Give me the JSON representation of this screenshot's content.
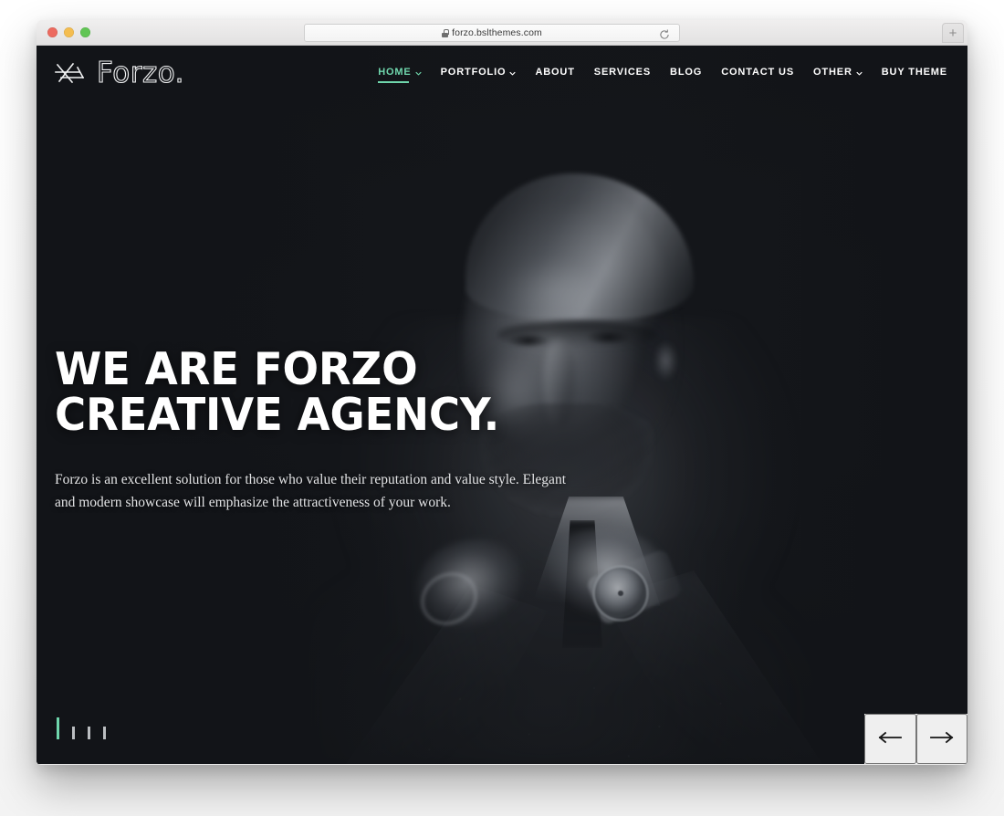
{
  "browser": {
    "url": "forzo.bslthemes.com",
    "lock_icon": "lock-icon",
    "reload_icon": "reload-icon",
    "newtab_label": "+",
    "traffic_lights": [
      "close-red",
      "minimize-yellow",
      "maximize-green"
    ]
  },
  "site": {
    "logo": {
      "mark": "forzo-glyph-icon",
      "wordmark": "Forzo."
    },
    "nav": [
      {
        "label": "HOME",
        "active": true,
        "has_dropdown": true
      },
      {
        "label": "PORTFOLIO",
        "active": false,
        "has_dropdown": true
      },
      {
        "label": "ABOUT",
        "active": false,
        "has_dropdown": false
      },
      {
        "label": "SERVICES",
        "active": false,
        "has_dropdown": false
      },
      {
        "label": "BLOG",
        "active": false,
        "has_dropdown": false
      },
      {
        "label": "CONTACT US",
        "active": false,
        "has_dropdown": false
      },
      {
        "label": "OTHER",
        "active": false,
        "has_dropdown": true
      },
      {
        "label": "BUY THEME",
        "active": false,
        "has_dropdown": false
      }
    ]
  },
  "hero": {
    "title": "WE ARE FORZO CREATIVE AGENCY.",
    "description": "Forzo is an excellent solution for those who value their reputation and value style. Elegant and modern showcase will emphasize the attractiveness of your work.",
    "image_alt": "Black and white photo of a bearded man in a suit adjusting his tie, wearing a wristwatch"
  },
  "slider": {
    "total_slides": 4,
    "active_slide": 1,
    "prev_icon": "arrow-left-icon",
    "next_icon": "arrow-right-icon"
  },
  "colors": {
    "accent": "#6fd6ac",
    "hero_background": "#1a1c21",
    "text_light": "#ffffff",
    "arrows_panel": "#ffffff"
  }
}
